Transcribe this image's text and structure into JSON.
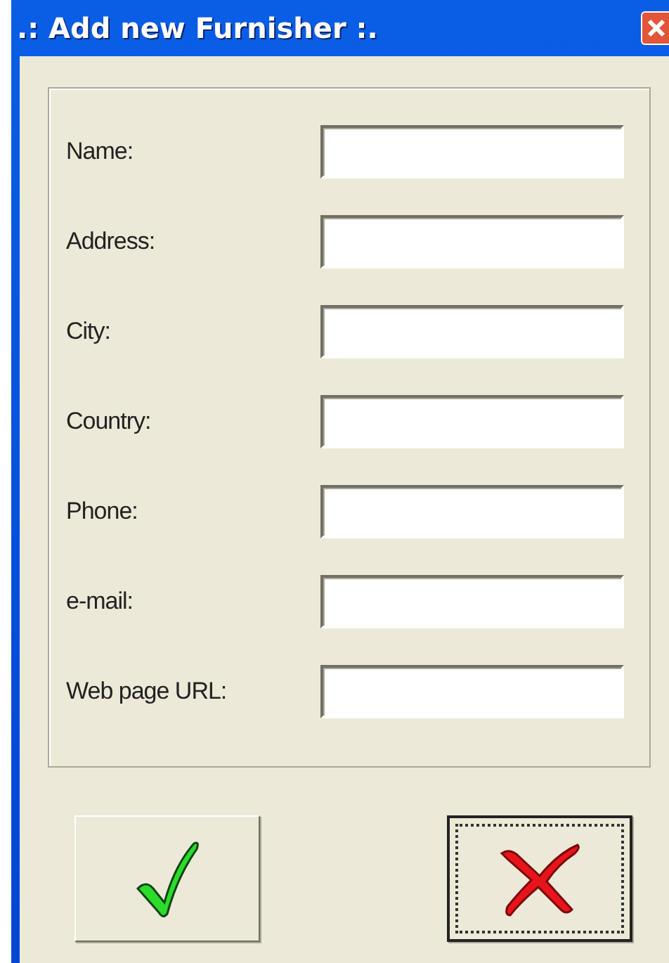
{
  "window": {
    "title": ".: Add new Furnisher :."
  },
  "fields": [
    {
      "label": "Name:"
    },
    {
      "label": "Address:"
    },
    {
      "label": "City:"
    },
    {
      "label": "Country:"
    },
    {
      "label": "Phone:"
    },
    {
      "label": "e-mail:"
    },
    {
      "label": "Web page URL:"
    }
  ],
  "buttons": [
    {
      "kind": "ok",
      "focused": false
    },
    {
      "kind": "cancel",
      "focused": true
    }
  ]
}
